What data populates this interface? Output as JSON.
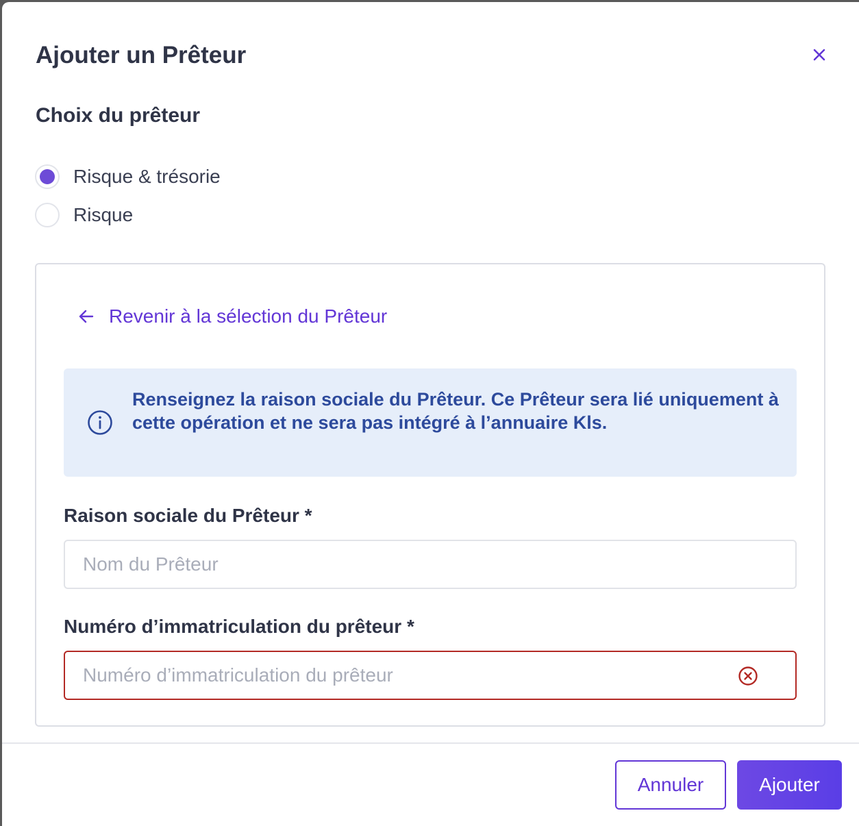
{
  "modal": {
    "title": "Ajouter un Prêteur",
    "close_icon": "close-icon"
  },
  "lender_choice": {
    "section_title": "Choix du prêteur",
    "options": [
      {
        "label": "Risque & trésorie",
        "selected": true
      },
      {
        "label": "Risque",
        "selected": false
      }
    ]
  },
  "card": {
    "back_link": {
      "icon": "arrow-left-icon",
      "label": "Revenir à la sélection du Prêteur"
    },
    "info": {
      "icon": "info-icon",
      "text": "Renseignez la raison sociale du Prêteur. Ce Prêteur sera lié uniquement à cette opération et ne sera pas intégré à l’annuaire Kls."
    },
    "fields": {
      "company_name": {
        "label": "Raison sociale du Prêteur *",
        "placeholder": "Nom du Prêteur",
        "value": ""
      },
      "registration_number": {
        "label": "Numéro d’immatriculation du prêteur *",
        "placeholder": "Numéro d’immatriculation du prêteur",
        "value": "",
        "error": true,
        "error_icon": "error-circle-icon"
      }
    }
  },
  "footer": {
    "cancel_label": "Annuler",
    "submit_label": "Ajouter"
  },
  "colors": {
    "accent": "#6236d6",
    "radio_selected": "#6d4bd7",
    "info_bg": "#e6eefa",
    "info_text": "#2d4a9c",
    "error": "#b32a25",
    "heading": "#2f3447"
  }
}
